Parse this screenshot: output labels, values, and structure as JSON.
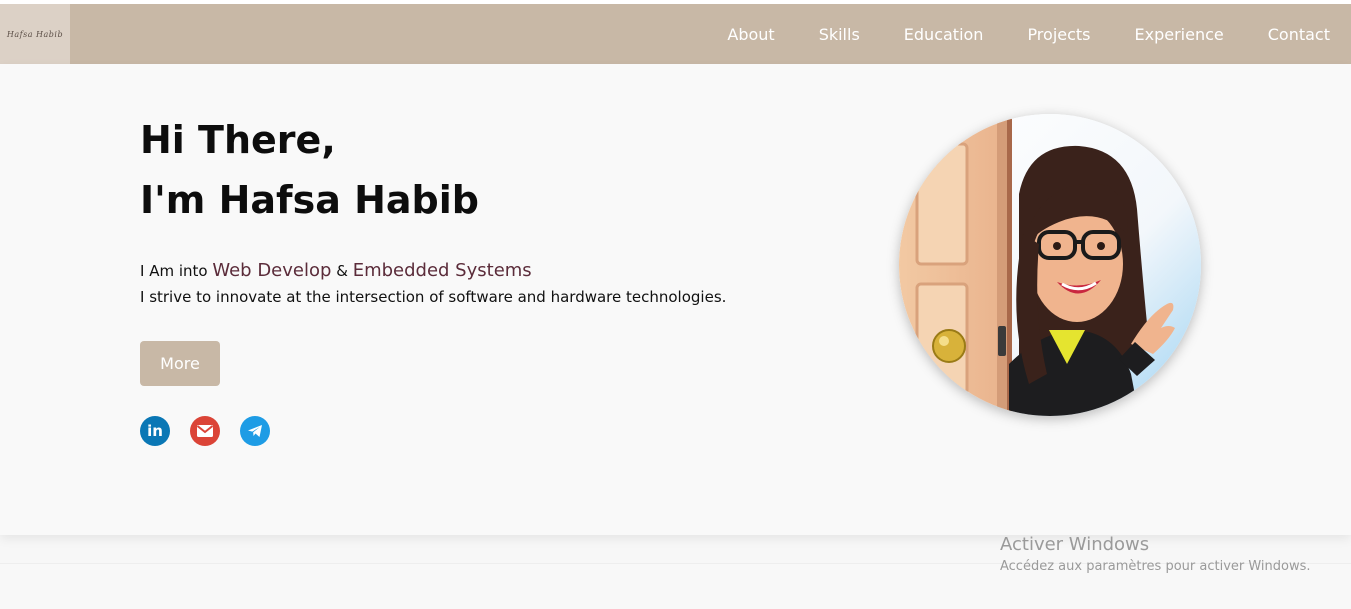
{
  "header": {
    "logo_text": "Hafsa Habib",
    "nav": [
      "About",
      "Skills",
      "Education",
      "Projects",
      "Experience",
      "Contact"
    ]
  },
  "hero": {
    "greeting_line1": "Hi There,",
    "greeting_line2": "I'm Hafsa Habib",
    "intro_prefix": "I Am into",
    "interest1": "Web Develop",
    "intro_and": "&",
    "interest2": "Embedded Systems",
    "tagline": "I strive to innovate at the intersection of software and hardware technologies.",
    "more_label": "More",
    "socials": [
      "linkedin-icon",
      "gmail-icon",
      "telegram-icon"
    ]
  },
  "watermark": {
    "title": "Activer Windows",
    "subtitle": "Accédez aux paramètres pour activer Windows."
  },
  "colors": {
    "navbar": "#c8b8a6",
    "accent_text": "#5b2c3a",
    "linkedin": "#0a77b5",
    "gmail": "#db4437",
    "telegram": "#1e9ce5"
  }
}
